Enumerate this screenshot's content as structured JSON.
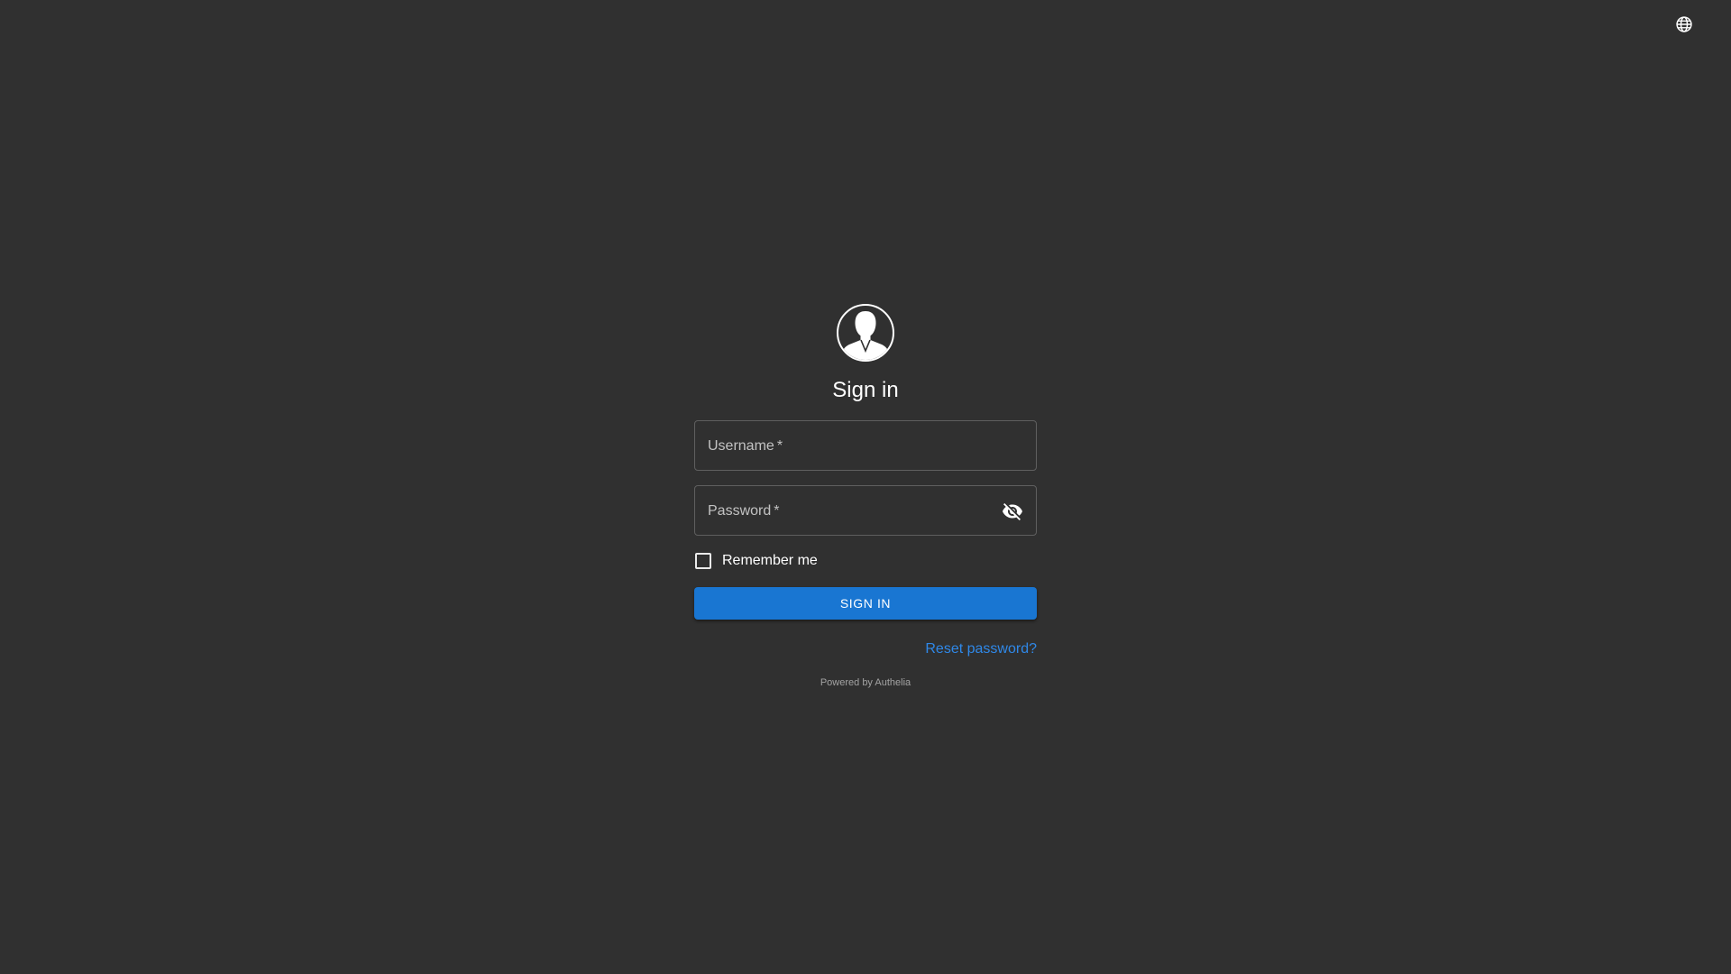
{
  "header": {
    "language_icon": "globe-icon"
  },
  "login": {
    "avatar_icon": "user-silhouette-icon",
    "title": "Sign in",
    "username": {
      "label": "Username",
      "required_marker": "*",
      "value": ""
    },
    "password": {
      "label": "Password",
      "required_marker": "*",
      "value": "",
      "toggle_icon": "eye-off-icon"
    },
    "remember_me": {
      "label": "Remember me",
      "checked": false
    },
    "submit_label": "SIGN IN",
    "reset_password_label": "Reset password?",
    "powered_by_prefix": "Powered by",
    "powered_by_name": "Authelia"
  },
  "colors": {
    "background": "#303030",
    "primary": "#1976d2",
    "link": "#2f88e8"
  }
}
